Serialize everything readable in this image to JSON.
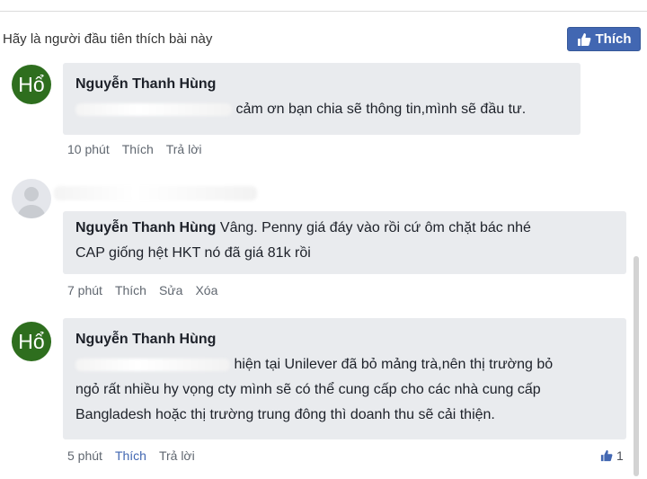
{
  "like_bar": {
    "prompt": "Hãy là người đầu tiên thích bài này",
    "like_button": "Thích"
  },
  "comments": [
    {
      "avatar_text": "Hổ",
      "author": "Nguyễn Thanh Hùng",
      "text": "cảm ơn bạn chia sẽ thông tin,mình sẽ đầu tư.",
      "time": "10 phút",
      "actions": [
        "Thích",
        "Trả lời"
      ]
    },
    {
      "avatar_text": "",
      "author": "Nguyễn Thanh Hùng",
      "text_line1": "Vâng. Penny giá đáy vào rồi cứ ôm chặt bác nhé",
      "text_line2": "CAP giống hệt HKT nó đã giá 81k rồi",
      "time": "7 phút",
      "actions": [
        "Thích",
        "Sửa",
        "Xóa"
      ]
    },
    {
      "avatar_text": "Hổ",
      "author": "Nguyễn Thanh Hùng",
      "text_line1": "hiện tại Unilever đã bỏ mảng trà,nên thị trường bỏ",
      "text_line2": "ngỏ rất nhiều hy vọng cty mình sẽ có thể cung cấp cho các nhà cung cấp",
      "text_line3": "Bangladesh hoặc thị trường trung đông thì doanh thu sẽ cải thiện.",
      "time": "5 phút",
      "actions": [
        "Thích",
        "Trả lời"
      ],
      "like_count": "1"
    }
  ],
  "colors": {
    "fb_blue": "#4267b2",
    "bubble_bg": "#e9ebee",
    "avatar_green": "#2e6e1e"
  }
}
